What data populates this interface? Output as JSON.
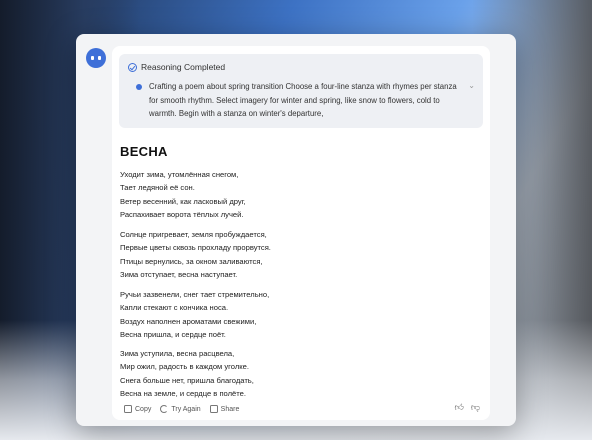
{
  "reasoning": {
    "status": "Reasoning Completed",
    "text": "Crafting a poem about spring transition Choose a four-line stanza with rhymes per stanza for smooth rhythm. Select imagery for winter and spring, like snow to flowers, cold to warmth. Begin with a stanza on winter's departure,"
  },
  "poem": {
    "title": "ВЕСНА",
    "stanzas": [
      [
        "Уходит зима, утомлённая снегом,",
        "Тает ледяной её сон.",
        "Ветер весенний, как ласковый друг,",
        "Распахивает ворота тёплых лучей."
      ],
      [
        "Солнце пригревает, земля пробуждается,",
        "Первые цветы сквозь прохладу прорвутся.",
        "Птицы вернулись, за окном заливаются,",
        "Зима отступает, весна наступает."
      ],
      [
        "Ручьи зазвенели, снег тает стремительно,",
        "Капли стекают с кончика носа.",
        "Воздух наполнен ароматами свежими,",
        "Весна пришла, и сердце поёт."
      ],
      [
        "Зима уступила, весна расцвела,",
        "Мир ожил, радость в каждом уголке.",
        "Снега больше нет, пришла благодать,",
        "Весна на земле, и сердце в полёте."
      ]
    ]
  },
  "actions": {
    "copy": "Copy",
    "try_again": "Try Again",
    "share": "Share"
  },
  "colors": {
    "accent": "#3e6fd8"
  }
}
